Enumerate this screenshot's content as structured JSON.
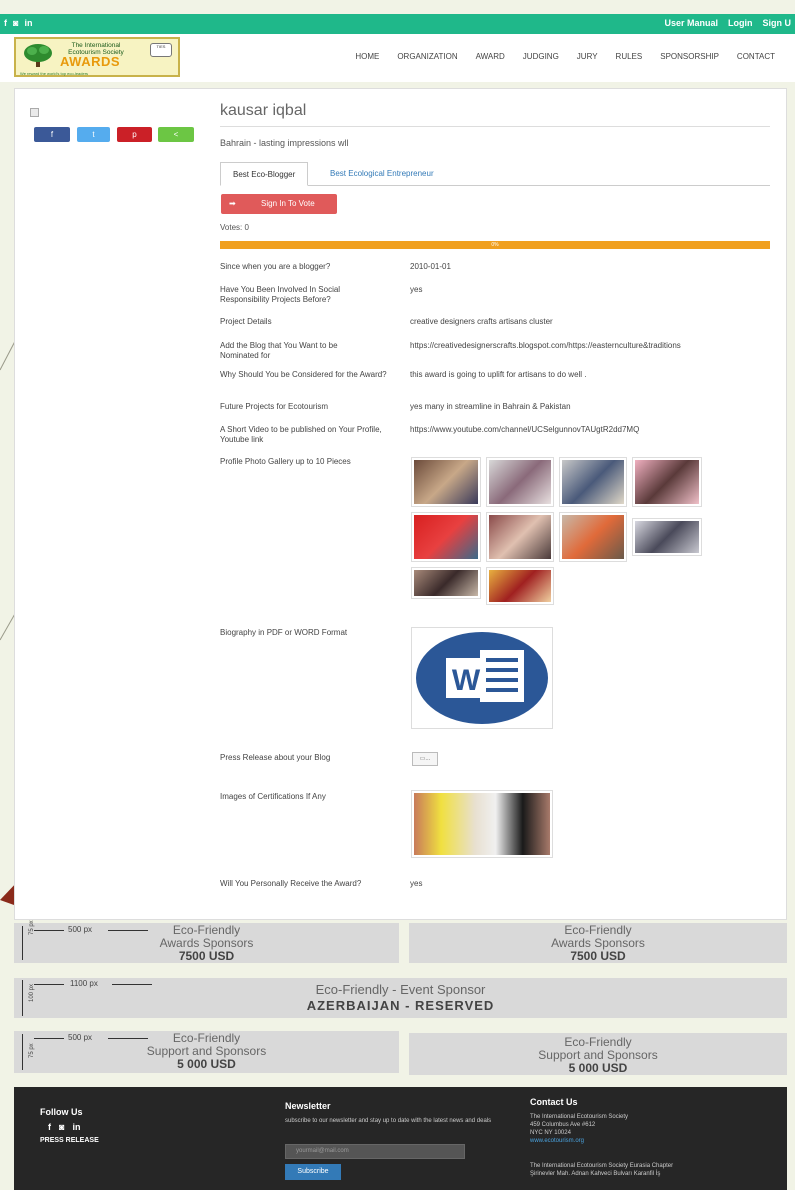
{
  "topbar": {
    "social": [
      "f",
      "◙",
      "in"
    ],
    "links": [
      "User Manual",
      "Login",
      "Sign U"
    ]
  },
  "logo": {
    "line1": "The International Ecotourism Society",
    "line2": "AWARDS",
    "line3": "We reward the world's top eco-leaders",
    "seal": "TIES"
  },
  "menu": [
    "HOME",
    "ORGANIZATION",
    "AWARD",
    "JUDGING",
    "JURY",
    "RULES",
    "SPONSORSHIP",
    "CONTACT"
  ],
  "share": {
    "fb": "f",
    "tw": "t",
    "pi": "p",
    "sh": "<"
  },
  "profile": {
    "name": "kausar iqbal",
    "subtitle": "Bahrain - lasting impressions wll",
    "tabs": [
      "Best Eco-Blogger",
      "Best Ecological Entrepreneur"
    ],
    "sign_button": "Sign In To Vote",
    "votes": "Votes: 0",
    "progress_label": "0%",
    "progress_fraction": 1.0
  },
  "fields": [
    {
      "q": "Since when you are a blogger?",
      "a": "2010-01-01"
    },
    {
      "q": "Have You Been Involved In Social Responsibility Projects Before?",
      "a": "yes"
    },
    {
      "q": "Project Details",
      "a": "creative designers crafts artisans cluster"
    },
    {
      "q": "Add the Blog that You Want to be Nominated for",
      "a": "https://creativedesignerscrafts.blogspot.com/https://easternculture&traditions"
    },
    {
      "q": "Why Should You be Considered for the Award?",
      "a": "this award is going to uplift for artisans to do well ."
    },
    {
      "q": "Future Projects for Ecotourism",
      "a": "yes many in streamline in Bahrain & Pakistan"
    },
    {
      "q": "A Short Video to be published on Your Profile, Youtube link",
      "a": "https://www.youtube.com/channel/UCSelgunnovTAUgtR2dd7MQ"
    },
    {
      "q": "Profile Photo Gallery up to 10 Pieces",
      "a": ""
    },
    {
      "q": "Biography in PDF or WORD Format",
      "a": ""
    },
    {
      "q": "Press Release about your Blog",
      "a": ""
    },
    {
      "q": "Images of Certifications If Any",
      "a": ""
    },
    {
      "q": "Will You Personally Receive the Award?",
      "a": "yes"
    }
  ],
  "sponsors": {
    "dim500": "500 px",
    "dim75": "75 px",
    "dim1100": "1100 px",
    "dim100": "100 px",
    "award_left": {
      "l1": "Eco-Friendly",
      "l2": "Awards Sponsors",
      "price": "7500 USD"
    },
    "award_right": {
      "l1": "Eco-Friendly",
      "l2": "Awards Sponsors",
      "price": "7500 USD"
    },
    "event": {
      "l1": "Eco-Friendly - Event Sponsor",
      "l2": "AZERBAIJAN - RESERVED"
    },
    "support_left": {
      "l1": "Eco-Friendly",
      "l2": "Support and Sponsors",
      "price": "5 000 USD"
    },
    "support_right": {
      "l1": "Eco-Friendly",
      "l2": "Support and Sponsors",
      "price": "5 000 USD"
    }
  },
  "footer": {
    "follow": "Follow Us",
    "icons": [
      "f",
      "◙",
      "in"
    ],
    "press": "PRESS RELEASE",
    "newsletter_title": "Newsletter",
    "newsletter_text": "subscribe to our newsletter and stay up to date with the latest news and deals",
    "email_placeholder": "yourmail@mail.com",
    "subscribe": "Subscribe",
    "contact_title": "Contact Us",
    "contact_l1": "The International Ecotourism Society",
    "contact_l2": "459 Columbus Ave #612",
    "contact_l3": "NYC NY 10024",
    "contact_link": "www.ecotourism.org",
    "eurasia_l1": "The International Ecotourism Society Eurasia Chapter",
    "eurasia_l2": "Şirinevler Mah. Adnan Kahveci Bulvarı Karanfil İş"
  },
  "colors": {
    "topbar": "#1fb88a",
    "progress": "#f0a020",
    "sign": "#e05a5a",
    "footer": "#262626"
  }
}
